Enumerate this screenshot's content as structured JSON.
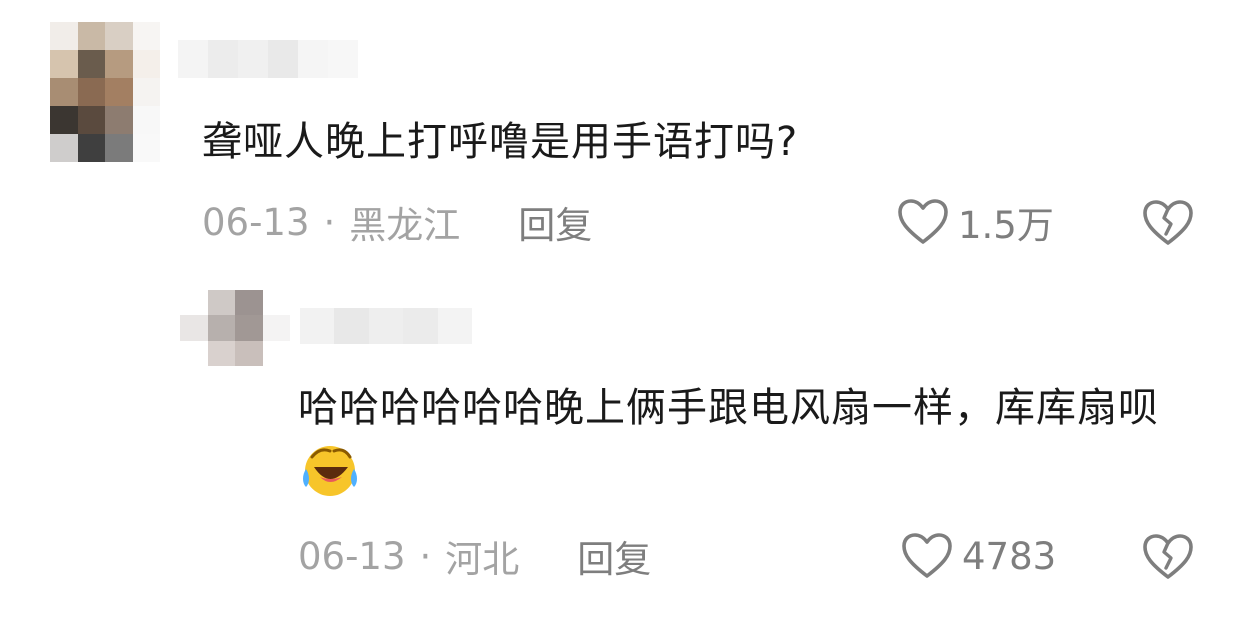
{
  "comments": [
    {
      "text": "聋哑人晚上打呼噜是用手语打吗?",
      "date": "06-13",
      "location": "黑龙江",
      "reply_label": "回复",
      "likes": "1.5万"
    },
    {
      "text": "哈哈哈哈哈哈晚上俩手跟电风扇一样，库库扇呗",
      "emoji": "laughing-crying-emoji",
      "date": "06-13",
      "location": "河北",
      "reply_label": "回复",
      "likes": "4783"
    }
  ],
  "separator": "·",
  "colors": {
    "text": "#1a1a1a",
    "meta": "#a3a3a3",
    "action": "#7e7e7e"
  },
  "avatar_1_pixels": [
    "#f1ede9",
    "#c9b9a6",
    "#d9cfc4",
    "#f7f5f3",
    "#d6c4ae",
    "#6a5c4d",
    "#b69b80",
    "#f4efea",
    "#a88d73",
    "#8a6a52",
    "#a37f62",
    "#f5f3f1",
    "#3b3631",
    "#5a4a3e",
    "#8d7c70",
    "#f8f8f8",
    "#cfcdcc",
    "#3f3f3f",
    "#7b7b7b",
    "#f9f9f9"
  ],
  "avatar_2_pixels": [
    "#ffffff",
    "#cfc9c6",
    "#9c9391",
    "#ffffff",
    "#e9e6e5",
    "#b7b0ad",
    "#a19895",
    "#f4f3f3",
    "#ffffff",
    "#d9d1ce",
    "#c9bfbb",
    "#ffffff"
  ],
  "username_1_pixels": [
    "#f4f4f4",
    "#ececec",
    "#f0f0f0",
    "#e9e9e9",
    "#f5f5f5",
    "#f7f7f7"
  ],
  "username_2_pixels": [
    "#f2f2f2",
    "#e8e8e8",
    "#eeeeee",
    "#ebebeb",
    "#f3f3f3"
  ]
}
